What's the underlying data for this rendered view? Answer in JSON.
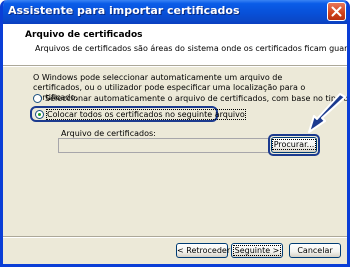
{
  "window": {
    "title": "Assistente para importar certificados"
  },
  "header": {
    "title": "Arquivo de certificados",
    "subtitle": "Arquivos de certificados são áreas do sistema onde os certificados ficam guardados."
  },
  "body": {
    "description": "O Windows pode seleccionar automaticamente um arquivo de certificados, ou o utilizador pode especificar uma localização para o certificado.",
    "radio_auto": {
      "label": "Seleccionar automaticamente o arquivo de certificados, com base no tipo de certificado",
      "checked": false
    },
    "radio_manual": {
      "label": "Colocar todos os certificados no seguinte arquivo",
      "checked": true
    },
    "store_label": "Arquivo de certificados:",
    "store_value": "",
    "browse_label": "Procurar..."
  },
  "footer": {
    "back_label": "< Retroceder",
    "next_label": "Seguinte >",
    "cancel_label": "Cancelar"
  },
  "annotation": {
    "arrow_color": "#1c3b8f",
    "highlight_color": "#1c3b8f"
  }
}
